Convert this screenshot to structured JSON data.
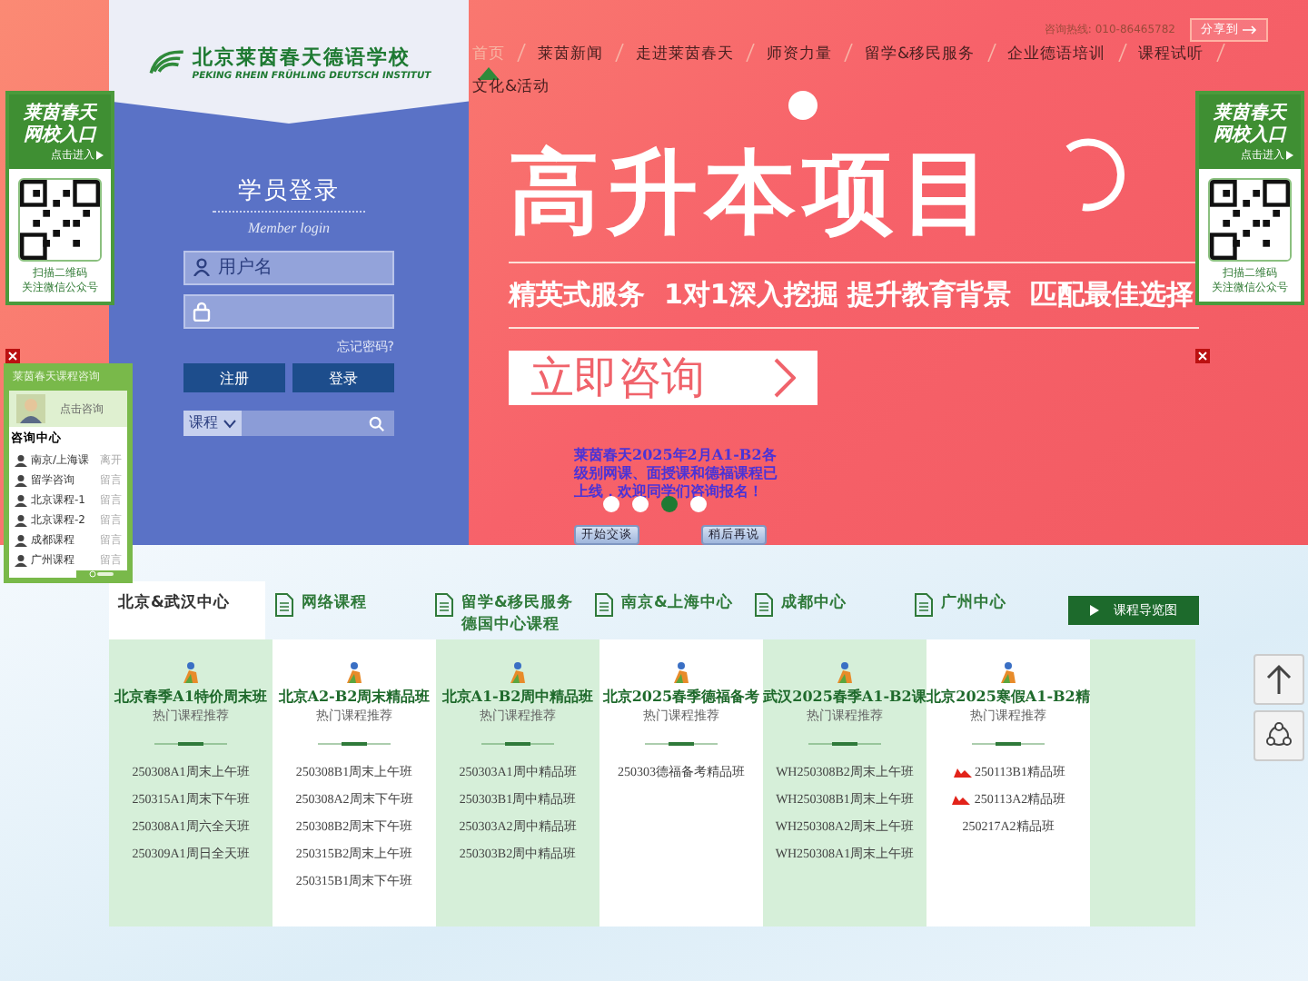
{
  "logo": {
    "name_cn": "北京莱茵春天德语学校",
    "name_de": "PEKING RHEIN FRÜHLING DEUTSCH INSTITUT"
  },
  "hotline": {
    "label": "咨询热线:",
    "number": "010-86465782"
  },
  "share_button": "分享到",
  "nav": [
    {
      "label": "首页",
      "selected": true
    },
    {
      "label": "莱茵新闻",
      "selected": false
    },
    {
      "label": "走进莱茵春天",
      "selected": false
    },
    {
      "label": "师资力量",
      "selected": false
    },
    {
      "label": "留学&移民服务",
      "selected": false
    },
    {
      "label": "企业德语培训",
      "selected": false
    },
    {
      "label": "课程试听",
      "selected": false
    },
    {
      "label": "文化&活动",
      "selected": false
    }
  ],
  "login": {
    "title": "学员登录",
    "subtitle": "Member login",
    "username_placeholder": "用户名",
    "forgot": "忘记密码?",
    "buttons": [
      "注册",
      "登录"
    ],
    "search_category": "课程"
  },
  "banner": {
    "headline": "高升本项目",
    "tagline": "精英式服务  1对1深入挖掘 提升教育背景  匹配最佳选择",
    "cta": "立即咨询",
    "dots": [
      {
        "selected": false
      },
      {
        "selected": false
      },
      {
        "selected": true
      },
      {
        "selected": false
      }
    ]
  },
  "notice": "莱茵春天2025年2月A1-B2各级别网课、面授课和德福课程已上线，欢迎同学们咨询报名！",
  "chat_buttons": [
    "开始交谈",
    "稍后再说"
  ],
  "side_widgets": [
    {
      "title": "莱茵春天",
      "subtitle": "网校入口",
      "enter": "点击进入",
      "caption_lines": [
        "扫描二维码",
        "关注微信公众号"
      ]
    },
    {
      "title": "莱茵春天",
      "subtitle": "网校入口",
      "enter": "点击进入",
      "caption_lines": [
        "扫描二维码",
        "关注微信公众号"
      ]
    }
  ],
  "chat_widget": {
    "title": "莱茵春天课程咨询",
    "consult": "点击咨询",
    "section": "咨询中心",
    "agents": [
      {
        "name": "南京/上海课",
        "status": "离开"
      },
      {
        "name": "留学咨询",
        "status": "留言"
      },
      {
        "name": "北京课程-1",
        "status": "留言"
      },
      {
        "name": "北京课程-2",
        "status": "留言"
      },
      {
        "name": "成都课程",
        "status": "留言"
      },
      {
        "name": "广州课程",
        "status": "留言"
      }
    ]
  },
  "tabs": [
    {
      "lines": [
        "北京&武汉中心"
      ],
      "selected": true
    },
    {
      "lines": [
        "网络课程"
      ],
      "selected": false
    },
    {
      "lines": [
        "留学&移民服务",
        "德国中心课程"
      ],
      "selected": false
    },
    {
      "lines": [
        "南京&上海中心"
      ],
      "selected": false
    },
    {
      "lines": [
        "成都中心"
      ],
      "selected": false
    },
    {
      "lines": [
        "广州中心"
      ],
      "selected": false
    }
  ],
  "guide_button": "课程导览图",
  "columns": [
    {
      "title": "北京春季A1特价周末班",
      "subtitle": "热门课程推荐",
      "courses": [
        {
          "name": "250308A1周末上午班",
          "hot": false
        },
        {
          "name": "250315A1周末下午班",
          "hot": false
        },
        {
          "name": "250308A1周六全天班",
          "hot": false
        },
        {
          "name": "250309A1周日全天班",
          "hot": false
        }
      ]
    },
    {
      "title": "北京A2-B2周末精品班",
      "subtitle": "热门课程推荐",
      "courses": [
        {
          "name": "250308B1周末上午班",
          "hot": false
        },
        {
          "name": "250308A2周末下午班",
          "hot": false
        },
        {
          "name": "250308B2周末下午班",
          "hot": false
        },
        {
          "name": "250315B2周末上午班",
          "hot": false
        },
        {
          "name": "250315B1周末下午班",
          "hot": false
        }
      ]
    },
    {
      "title": "北京A1-B2周中精品班",
      "subtitle": "热门课程推荐",
      "courses": [
        {
          "name": "250303A1周中精品班",
          "hot": false
        },
        {
          "name": "250303B1周中精品班",
          "hot": false
        },
        {
          "name": "250303A2周中精品班",
          "hot": false
        },
        {
          "name": "250303B2周中精品班",
          "hot": false
        }
      ]
    },
    {
      "title": "北京2025春季德福备考",
      "subtitle": "热门课程推荐",
      "courses": [
        {
          "name": "250303德福备考精品班",
          "hot": false
        }
      ]
    },
    {
      "title": "武汉2025春季A1-B2课",
      "subtitle": "热门课程推荐",
      "courses": [
        {
          "name": "WH250308B2周末上午班",
          "hot": false
        },
        {
          "name": "WH250308B1周末上午班",
          "hot": false
        },
        {
          "name": "WH250308A2周末上午班",
          "hot": false
        },
        {
          "name": "WH250308A1周末上午班",
          "hot": false
        }
      ]
    },
    {
      "title": "北京2025寒假A1-B2精",
      "subtitle": "热门课程推荐",
      "courses": [
        {
          "name": "250113B1精品班",
          "hot": true
        },
        {
          "name": "250113A2精品班",
          "hot": true
        },
        {
          "name": "250217A2精品班",
          "hot": false
        }
      ]
    }
  ]
}
